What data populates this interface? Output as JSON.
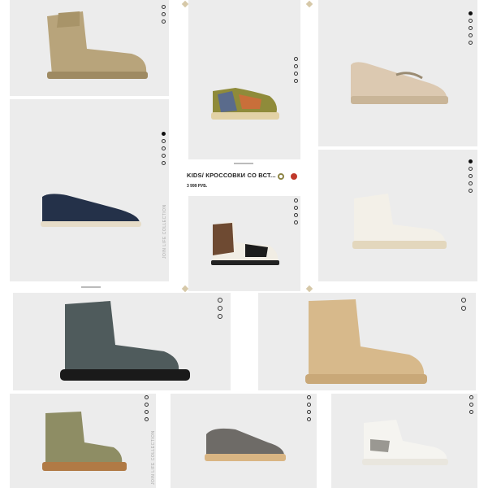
{
  "brand_vertical": "JOIN LIFE COLLECTION",
  "info_card": {
    "name": "KIDS/ КРОССОВКИ СО ВСТ...",
    "price": "3 999 РУБ.",
    "swatch_colors": [
      "#8c8445",
      "#c0392b"
    ]
  },
  "products": [
    {
      "id": "suede-high-boot",
      "color": "#b6a27a"
    },
    {
      "id": "trail-sneaker",
      "color": "#8b8a3a"
    },
    {
      "id": "chain-loafer",
      "color": "#d9c7b0"
    },
    {
      "id": "navy-loafer",
      "color": "#27334a"
    },
    {
      "id": "brown-hightop",
      "color": "#6e4a32"
    },
    {
      "id": "white-hightop",
      "color": "#f2efe6"
    },
    {
      "id": "glitter-boot",
      "color": "#4f5b5c"
    },
    {
      "id": "beige-lace-boot",
      "color": "#d8b88a"
    },
    {
      "id": "khaki-boot",
      "color": "#8c8a62"
    },
    {
      "id": "grey-sneaker",
      "color": "#6d6a66"
    },
    {
      "id": "white-velcro-sneaker",
      "color": "#f4f3ef"
    }
  ]
}
